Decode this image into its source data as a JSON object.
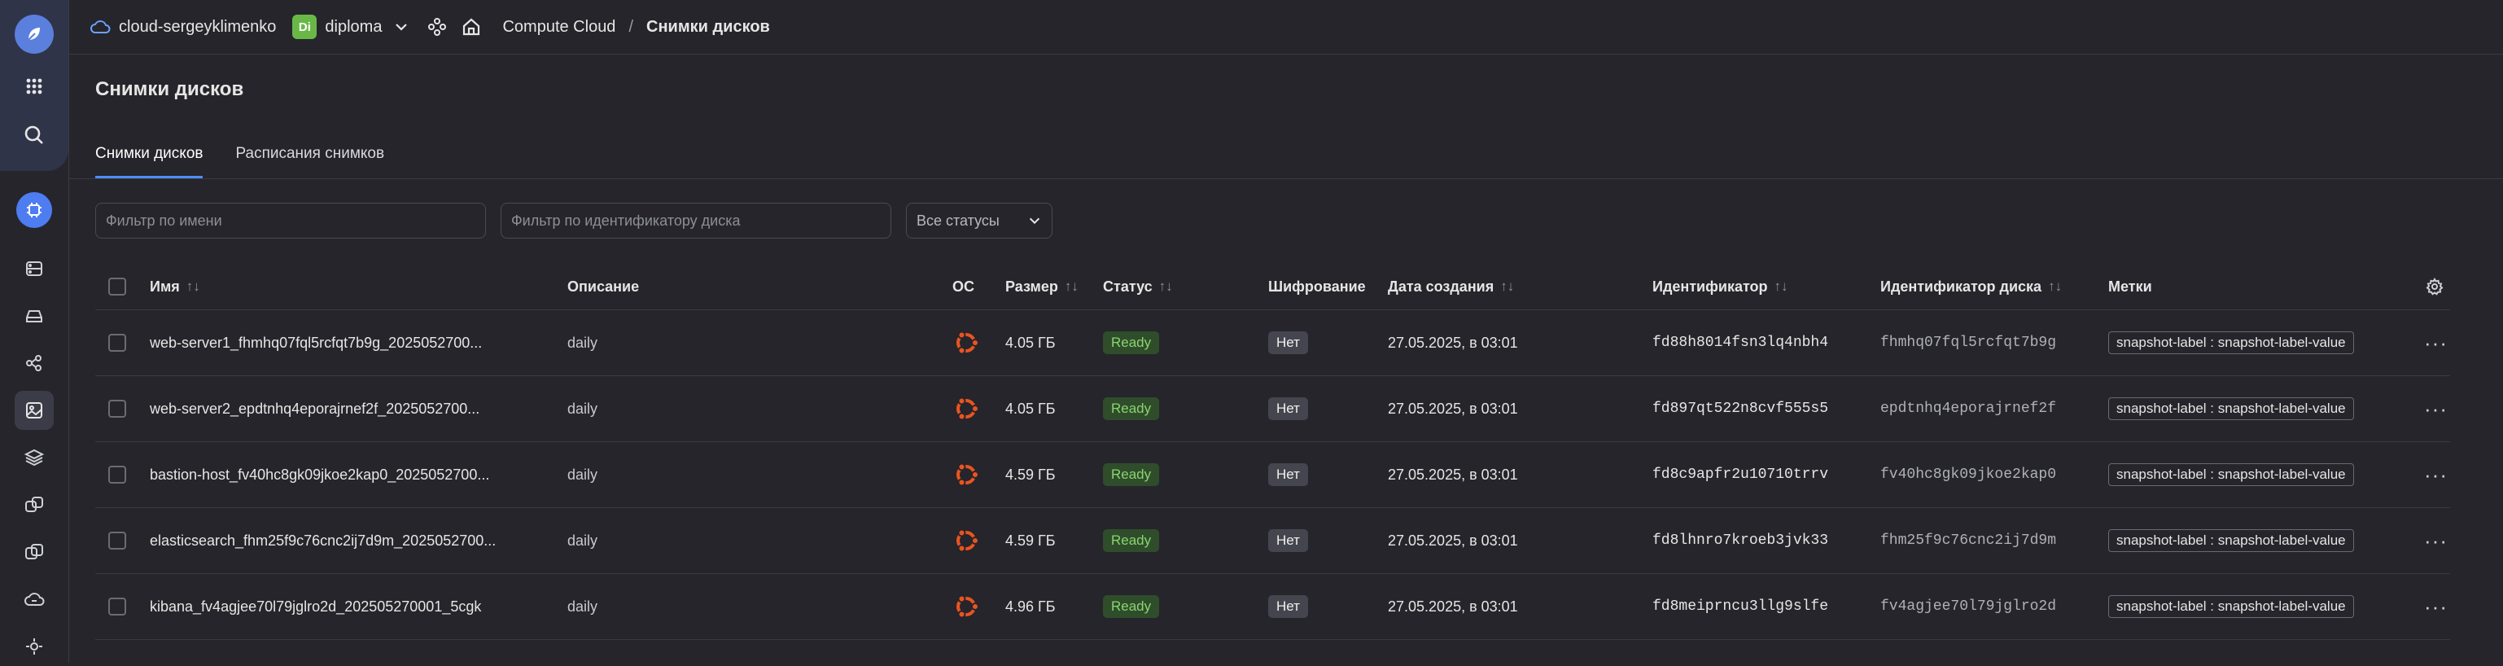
{
  "topbar": {
    "cloud_name": "cloud-sergeyklimenko",
    "folder_badge": "Di",
    "folder_name": "diploma",
    "breadcrumb_service": "Compute Cloud",
    "breadcrumb_sep": "/",
    "breadcrumb_current": "Снимки дисков"
  },
  "page": {
    "title": "Снимки дисков",
    "tabs": [
      {
        "label": "Снимки дисков"
      },
      {
        "label": "Расписания снимков"
      }
    ]
  },
  "filters": {
    "name_placeholder": "Фильтр по имени",
    "disk_placeholder": "Фильтр по идентификатору диска",
    "status_select": "Все статусы"
  },
  "table": {
    "columns": {
      "name": "Имя",
      "description": "Описание",
      "os": "ОС",
      "size": "Размер",
      "status": "Статус",
      "encryption": "Шифрование",
      "created": "Дата создания",
      "id": "Идентификатор",
      "disk_id": "Идентификатор диска",
      "labels": "Метки"
    },
    "rows": [
      {
        "name": "web-server1_fhmhq07fql5rcfqt7b9g_2025052700...",
        "description": "daily",
        "os_icon": "ubuntu-icon",
        "size": "4.05 ГБ",
        "status": "Ready",
        "encryption": "Нет",
        "created": "27.05.2025, в 03:01",
        "id": "fd88h8014fsn3lq4nbh4",
        "disk_id": "fhmhq07fql5rcfqt7b9g",
        "label": "snapshot-label : snapshot-label-value"
      },
      {
        "name": "web-server2_epdtnhq4eporajrnef2f_2025052700...",
        "description": "daily",
        "os_icon": "ubuntu-icon",
        "size": "4.05 ГБ",
        "status": "Ready",
        "encryption": "Нет",
        "created": "27.05.2025, в 03:01",
        "id": "fd897qt522n8cvf555s5",
        "disk_id": "epdtnhq4eporajrnef2f",
        "label": "snapshot-label : snapshot-label-value"
      },
      {
        "name": "bastion-host_fv40hc8gk09jkoe2kap0_2025052700...",
        "description": "daily",
        "os_icon": "ubuntu-icon",
        "size": "4.59 ГБ",
        "status": "Ready",
        "encryption": "Нет",
        "created": "27.05.2025, в 03:01",
        "id": "fd8c9apfr2u10710trrv",
        "disk_id": "fv40hc8gk09jkoe2kap0",
        "label": "snapshot-label : snapshot-label-value"
      },
      {
        "name": "elasticsearch_fhm25f9c76cnc2ij7d9m_2025052700...",
        "description": "daily",
        "os_icon": "ubuntu-icon",
        "size": "4.59 ГБ",
        "status": "Ready",
        "encryption": "Нет",
        "created": "27.05.2025, в 03:01",
        "id": "fd8lhnro7kroeb3jvk33",
        "disk_id": "fhm25f9c76cnc2ij7d9m",
        "label": "snapshot-label : snapshot-label-value"
      },
      {
        "name": "kibana_fv4agjee70l79jglro2d_202505270001_5cgk",
        "description": "daily",
        "os_icon": "ubuntu-icon",
        "size": "4.96 ГБ",
        "status": "Ready",
        "encryption": "Нет",
        "created": "27.05.2025, в 03:01",
        "id": "fd8meiprncu3llg9slfe",
        "disk_id": "fv4agjee70l79jglro2d",
        "label": "snapshot-label : snapshot-label-value"
      }
    ]
  },
  "colors": {
    "background": "#25252b",
    "accent": "#4d8eff",
    "ready": "#8ad46f",
    "ubuntu": "#e95420",
    "folder_badge": "#69b847"
  }
}
